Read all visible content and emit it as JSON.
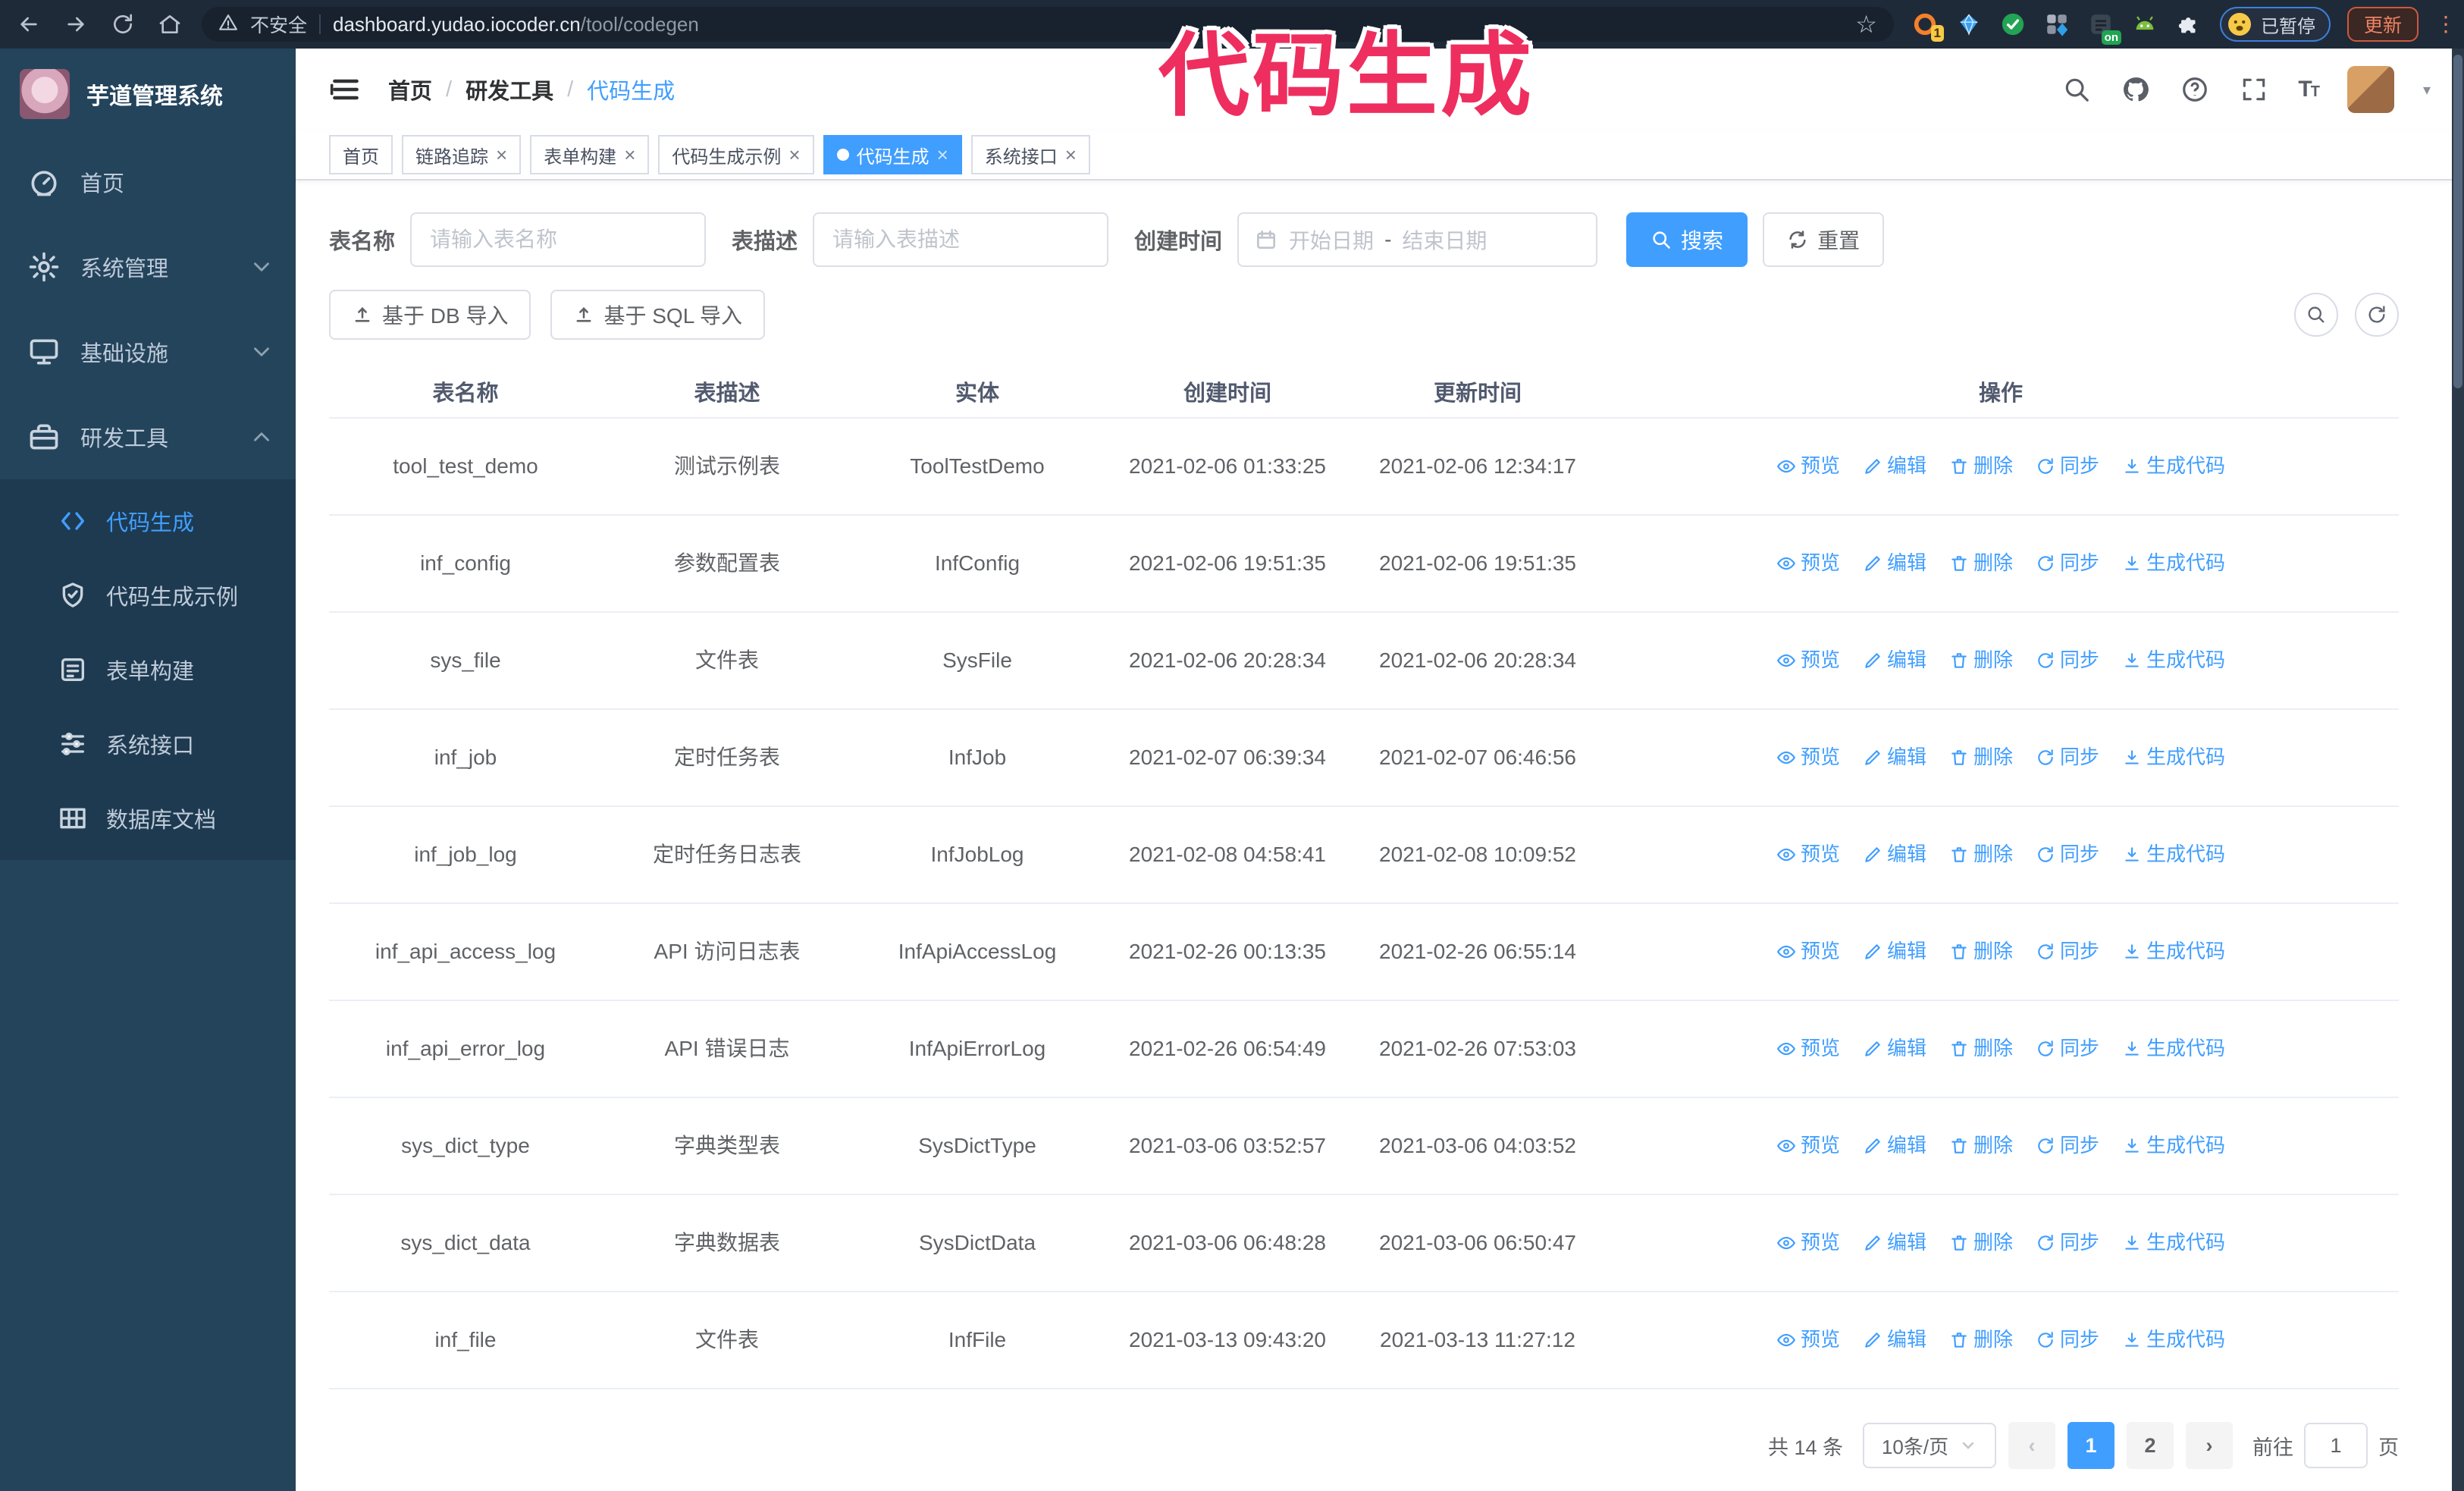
{
  "colors": {
    "primary": "#409eff",
    "annotation": "#ee2e5f",
    "sidebar_bg": "#24445c",
    "submenu_bg": "#1e3a50",
    "browser_bar_bg": "#1f2a38"
  },
  "annotation": {
    "text": "代码生成"
  },
  "browser": {
    "security_label": "不安全",
    "url_host": "dashboard.yudao.iocoder.cn",
    "url_path": "/tool/codegen",
    "extension_badge": "1",
    "extension_on_badge": "on",
    "paused_badge": "已暂停",
    "update_button": "更新"
  },
  "sidebar": {
    "logo_title": "芋道管理系统",
    "items": [
      {
        "label": "首页",
        "icon": "dashboard-icon",
        "expandable": false,
        "expanded": false
      },
      {
        "label": "系统管理",
        "icon": "gear-icon",
        "expandable": true,
        "expanded": false
      },
      {
        "label": "基础设施",
        "icon": "monitor-icon",
        "expandable": true,
        "expanded": false
      },
      {
        "label": "研发工具",
        "icon": "toolbox-icon",
        "expandable": true,
        "expanded": true
      }
    ],
    "submenu": [
      {
        "label": "代码生成",
        "icon": "code-icon",
        "active": true
      },
      {
        "label": "代码生成示例",
        "icon": "example-icon",
        "active": false
      },
      {
        "label": "表单构建",
        "icon": "form-icon",
        "active": false
      },
      {
        "label": "系统接口",
        "icon": "api-icon",
        "active": false
      },
      {
        "label": "数据库文档",
        "icon": "database-doc-icon",
        "active": false
      }
    ]
  },
  "header": {
    "breadcrumb": [
      "首页",
      "研发工具",
      "代码生成"
    ]
  },
  "tabs": [
    {
      "label": "首页",
      "closable": false,
      "active": false
    },
    {
      "label": "链路追踪",
      "closable": true,
      "active": false
    },
    {
      "label": "表单构建",
      "closable": true,
      "active": false
    },
    {
      "label": "代码生成示例",
      "closable": true,
      "active": false
    },
    {
      "label": "代码生成",
      "closable": true,
      "active": true
    },
    {
      "label": "系统接口",
      "closable": true,
      "active": false
    }
  ],
  "filters": {
    "table_name_label": "表名称",
    "table_name_placeholder": "请输入表名称",
    "table_desc_label": "表描述",
    "table_desc_placeholder": "请输入表描述",
    "create_time_label": "创建时间",
    "start_placeholder": "开始日期",
    "range_separator": "-",
    "end_placeholder": "结束日期",
    "search_label": "搜索",
    "reset_label": "重置"
  },
  "toolbar": {
    "import_db_label": "基于 DB 导入",
    "import_sql_label": "基于 SQL 导入"
  },
  "table": {
    "columns": [
      "表名称",
      "表描述",
      "实体",
      "创建时间",
      "更新时间",
      "操作"
    ],
    "actions": [
      "预览",
      "编辑",
      "删除",
      "同步",
      "生成代码"
    ],
    "rows": [
      {
        "name": "tool_test_demo",
        "desc": "测试示例表",
        "entity": "ToolTestDemo",
        "created": "2021-02-06 01:33:25",
        "updated": "2021-02-06 12:34:17"
      },
      {
        "name": "inf_config",
        "desc": "参数配置表",
        "entity": "InfConfig",
        "created": "2021-02-06 19:51:35",
        "updated": "2021-02-06 19:51:35"
      },
      {
        "name": "sys_file",
        "desc": "文件表",
        "entity": "SysFile",
        "created": "2021-02-06 20:28:34",
        "updated": "2021-02-06 20:28:34"
      },
      {
        "name": "inf_job",
        "desc": "定时任务表",
        "entity": "InfJob",
        "created": "2021-02-07 06:39:34",
        "updated": "2021-02-07 06:46:56"
      },
      {
        "name": "inf_job_log",
        "desc": "定时任务日志表",
        "entity": "InfJobLog",
        "created": "2021-02-08 04:58:41",
        "updated": "2021-02-08 10:09:52"
      },
      {
        "name": "inf_api_access_log",
        "desc": "API 访问日志表",
        "entity": "InfApiAccessLog",
        "created": "2021-02-26 00:13:35",
        "updated": "2021-02-26 06:55:14"
      },
      {
        "name": "inf_api_error_log",
        "desc": "API 错误日志",
        "entity": "InfApiErrorLog",
        "created": "2021-02-26 06:54:49",
        "updated": "2021-02-26 07:53:03"
      },
      {
        "name": "sys_dict_type",
        "desc": "字典类型表",
        "entity": "SysDictType",
        "created": "2021-03-06 03:52:57",
        "updated": "2021-03-06 04:03:52"
      },
      {
        "name": "sys_dict_data",
        "desc": "字典数据表",
        "entity": "SysDictData",
        "created": "2021-03-06 06:48:28",
        "updated": "2021-03-06 06:50:47"
      },
      {
        "name": "inf_file",
        "desc": "文件表",
        "entity": "InfFile",
        "created": "2021-03-13 09:43:20",
        "updated": "2021-03-13 11:27:12"
      }
    ]
  },
  "pagination": {
    "total_label": "共 14 条",
    "page_size": "10条/页",
    "pages": [
      "1",
      "2"
    ],
    "active_page": "1",
    "prev_label": "‹",
    "next_label": "›",
    "goto_label": "前往",
    "goto_value": "1",
    "page_label": "页"
  }
}
